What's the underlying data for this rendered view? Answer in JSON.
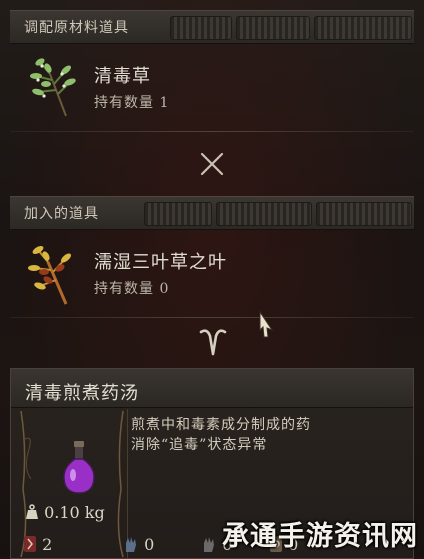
{
  "materials_header": {
    "label": "调配原材料道具"
  },
  "material": {
    "name": "清毒草",
    "qty": "持有数量 1",
    "icon": "herb-icon"
  },
  "operator_times": {
    "icon": "times-icon"
  },
  "added_header": {
    "label": "加入的道具"
  },
  "added_item": {
    "name": "濡湿三叶草之叶",
    "qty": "持有数量 0",
    "icon": "clover-leaf-icon"
  },
  "operator_result": {
    "icon": "chevron-down-icon"
  },
  "result": {
    "title": "清毒煎煮药汤",
    "desc_line1": "煎煮中和毒素成分制成的药",
    "desc_line2": "消除“追毒”状态异常",
    "weight": "0.10 kg",
    "icon": "potion-flask-icon",
    "stats": [
      "2",
      "0",
      "0",
      "0"
    ]
  },
  "watermark": "承通手游资讯网",
  "colors": {
    "potion": "#9a2fc8",
    "accent_gold": "#b89a5a",
    "text": "#d8d2c4"
  }
}
